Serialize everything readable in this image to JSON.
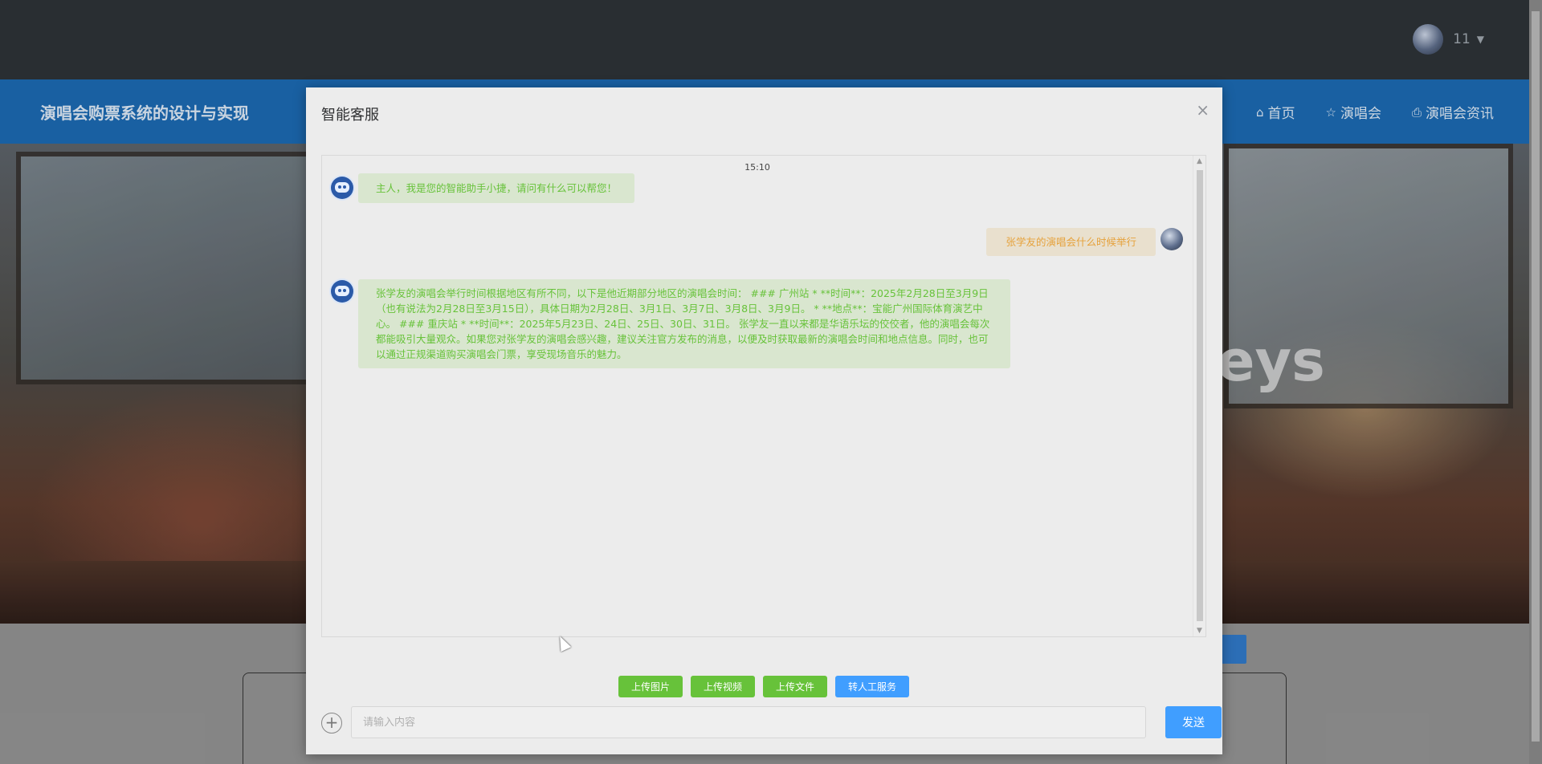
{
  "header": {
    "user_name": "11",
    "user_caret": "▼"
  },
  "nav": {
    "site_title": "演唱会购票系统的设计与实现",
    "links": [
      {
        "icon": "home-icon",
        "glyph": "⌂",
        "label": "首页"
      },
      {
        "icon": "star-icon",
        "glyph": "☆",
        "label": "演唱会"
      },
      {
        "icon": "bag-icon",
        "glyph": "⎙",
        "label": "演唱会资讯"
      }
    ]
  },
  "banner": {
    "text": "eys"
  },
  "modal": {
    "title": "智能客服",
    "close": "×",
    "time": "15:10",
    "messages": [
      {
        "from": "bot",
        "text": "主人，我是您的智能助手小捷，请问有什么可以帮您！"
      },
      {
        "from": "user",
        "text": "张学友的演唱会什么时候举行"
      },
      {
        "from": "bot",
        "text": "张学友的演唱会举行时间根据地区有所不同，以下是他近期部分地区的演唱会时间： ### 广州站 * **时间**：2025年2月28日至3月9日（也有说法为2月28日至3月15日），具体日期为2月28日、3月1日、3月7日、3月8日、3月9日。 * **地点**：宝能广州国际体育演艺中心。 ### 重庆站 * **时间**：2025年5月23日、24日、25日、30日、31日。 张学友一直以来都是华语乐坛的佼佼者，他的演唱会每次都能吸引大量观众。如果您对张学友的演唱会感兴趣，建议关注官方发布的消息，以便及时获取最新的演唱会时间和地点信息。同时，也可以通过正规渠道购买演唱会门票，享受现场音乐的魅力。"
      }
    ],
    "tools": {
      "upload_image": "上传图片",
      "upload_video": "上传视频",
      "upload_file": "上传文件",
      "human_service": "转人工服务"
    },
    "input_placeholder": "请输入内容",
    "send": "发送"
  },
  "colors": {
    "nav_blue": "#1b66ad",
    "topbar": "#2c3136",
    "bot_text": "#67c23a",
    "user_text": "#e6a23c",
    "primary": "#409eff"
  }
}
